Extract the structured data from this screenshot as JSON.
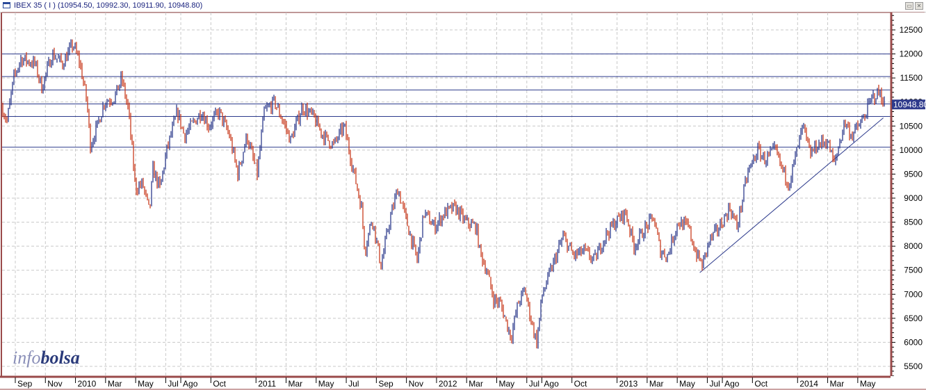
{
  "window": {
    "title": "IBEX 35 ( I ) (10954.50, 10992.30, 10911.90, 10948.80)",
    "restore": "▭",
    "close": "✕"
  },
  "logo": {
    "part1": "info",
    "part2": "bolsa"
  },
  "colors": {
    "up": "#2c3a8c",
    "down": "#c83c1e",
    "axis": "#9a4a4a",
    "grid": "#c8c8c8",
    "lines": "#2c3a8c",
    "last_bg": "#2e3a8c"
  },
  "chart_data": {
    "type": "ohlc",
    "title": "IBEX 35 ( I )",
    "ohlc_last": {
      "open": 10954.5,
      "high": 10992.3,
      "low": 10911.9,
      "close": 10948.8
    },
    "last_price_label": "10948.80",
    "ylim": [
      5250,
      12800
    ],
    "yticks": [
      5500,
      6000,
      6500,
      7000,
      7500,
      8000,
      8500,
      9000,
      9500,
      10000,
      10500,
      11000,
      11500,
      12000,
      12500
    ],
    "x_unit": "months since Sep 2009",
    "xlim": [
      -0.95,
      57.9
    ],
    "xticks": [
      {
        "t": 0,
        "label": "Sep"
      },
      {
        "t": 2,
        "label": "Nov"
      },
      {
        "t": 4,
        "label": "2010"
      },
      {
        "t": 6,
        "label": "Mar"
      },
      {
        "t": 8,
        "label": "May"
      },
      {
        "t": 10,
        "label": "Jul"
      },
      {
        "t": 11,
        "label": "Ago"
      },
      {
        "t": 13,
        "label": "Oct"
      },
      {
        "t": 16,
        "label": "2011"
      },
      {
        "t": 18,
        "label": "Mar"
      },
      {
        "t": 20,
        "label": "May"
      },
      {
        "t": 22,
        "label": "Jul"
      },
      {
        "t": 24,
        "label": "Sep"
      },
      {
        "t": 26,
        "label": "Nov"
      },
      {
        "t": 28,
        "label": "2012"
      },
      {
        "t": 30,
        "label": "Mar"
      },
      {
        "t": 32,
        "label": "May"
      },
      {
        "t": 34,
        "label": "Jul"
      },
      {
        "t": 35,
        "label": "Ago"
      },
      {
        "t": 37,
        "label": "Oct"
      },
      {
        "t": 40,
        "label": "2013"
      },
      {
        "t": 42,
        "label": "Mar"
      },
      {
        "t": 44,
        "label": "May"
      },
      {
        "t": 46,
        "label": "Jul"
      },
      {
        "t": 47,
        "label": "Ago"
      },
      {
        "t": 49,
        "label": "Oct"
      },
      {
        "t": 52,
        "label": "2014"
      },
      {
        "t": 54,
        "label": "Mar"
      },
      {
        "t": 56,
        "label": "May"
      }
    ],
    "horizontal_levels": [
      12000,
      11530,
      11250,
      10960,
      10700,
      10060
    ],
    "trendline": [
      [
        45.5,
        7450
      ],
      [
        57.7,
        10670
      ]
    ],
    "price_path": [
      [
        -0.9,
        10900
      ],
      [
        -0.55,
        10600
      ],
      [
        -0.1,
        11500
      ],
      [
        0.37,
        11900
      ],
      [
        1.3,
        11800
      ],
      [
        1.76,
        11300
      ],
      [
        2.45,
        12000
      ],
      [
        3.14,
        11800
      ],
      [
        3.84,
        12200
      ],
      [
        4.3,
        11800
      ],
      [
        4.76,
        11000
      ],
      [
        4.99,
        10100
      ],
      [
        5.45,
        10500
      ],
      [
        5.92,
        11000
      ],
      [
        6.61,
        11100
      ],
      [
        7.07,
        11500
      ],
      [
        7.53,
        10800
      ],
      [
        7.99,
        9200
      ],
      [
        8.46,
        9300
      ],
      [
        8.92,
        8700
      ],
      [
        9.15,
        9600
      ],
      [
        9.61,
        9200
      ],
      [
        10.07,
        10000
      ],
      [
        10.77,
        10800
      ],
      [
        11.23,
        10300
      ],
      [
        11.69,
        10500
      ],
      [
        12.38,
        10800
      ],
      [
        12.85,
        10500
      ],
      [
        13.54,
        10800
      ],
      [
        14.23,
        10300
      ],
      [
        14.79,
        9500
      ],
      [
        15.39,
        10300
      ],
      [
        16.08,
        9500
      ],
      [
        16.54,
        10800
      ],
      [
        17.24,
        11000
      ],
      [
        17.93,
        10500
      ],
      [
        18.3,
        10200
      ],
      [
        19.08,
        10900
      ],
      [
        19.78,
        10700
      ],
      [
        20.47,
        10300
      ],
      [
        21.16,
        10100
      ],
      [
        21.86,
        10500
      ],
      [
        22.32,
        9800
      ],
      [
        23.01,
        8800
      ],
      [
        23.24,
        7900
      ],
      [
        23.71,
        8600
      ],
      [
        24.31,
        7600
      ],
      [
        24.86,
        8500
      ],
      [
        25.42,
        9200
      ],
      [
        26.02,
        8500
      ],
      [
        26.71,
        7700
      ],
      [
        27.17,
        8700
      ],
      [
        27.87,
        8400
      ],
      [
        28.56,
        8700
      ],
      [
        29.25,
        8800
      ],
      [
        29.94,
        8500
      ],
      [
        30.64,
        8400
      ],
      [
        30.87,
        7900
      ],
      [
        31.33,
        7500
      ],
      [
        31.79,
        6900
      ],
      [
        32.26,
        6800
      ],
      [
        32.95,
        6100
      ],
      [
        33.41,
        6800
      ],
      [
        33.87,
        7100
      ],
      [
        34.33,
        6400
      ],
      [
        34.66,
        6000
      ],
      [
        35.03,
        7000
      ],
      [
        35.72,
        7600
      ],
      [
        36.41,
        8200
      ],
      [
        37.11,
        7800
      ],
      [
        37.8,
        7900
      ],
      [
        38.49,
        7700
      ],
      [
        39.19,
        8200
      ],
      [
        39.88,
        8500
      ],
      [
        40.57,
        8700
      ],
      [
        41.13,
        8000
      ],
      [
        41.73,
        8300
      ],
      [
        42.42,
        8600
      ],
      [
        42.88,
        7900
      ],
      [
        43.35,
        7800
      ],
      [
        44.04,
        8500
      ],
      [
        44.73,
        8400
      ],
      [
        45.19,
        7900
      ],
      [
        45.66,
        7600
      ],
      [
        46.12,
        8100
      ],
      [
        46.81,
        8400
      ],
      [
        47.5,
        8800
      ],
      [
        47.97,
        8400
      ],
      [
        48.66,
        9500
      ],
      [
        49.35,
        10000
      ],
      [
        49.82,
        9800
      ],
      [
        50.51,
        10000
      ],
      [
        50.97,
        9600
      ],
      [
        51.43,
        9300
      ],
      [
        51.89,
        9900
      ],
      [
        52.36,
        10500
      ],
      [
        52.82,
        9900
      ],
      [
        53.28,
        10100
      ],
      [
        53.97,
        10200
      ],
      [
        54.44,
        9700
      ],
      [
        55.13,
        10600
      ],
      [
        55.59,
        10300
      ],
      [
        56.29,
        10600
      ],
      [
        56.98,
        11100
      ],
      [
        57.44,
        11200
      ],
      [
        57.81,
        10950
      ]
    ]
  }
}
